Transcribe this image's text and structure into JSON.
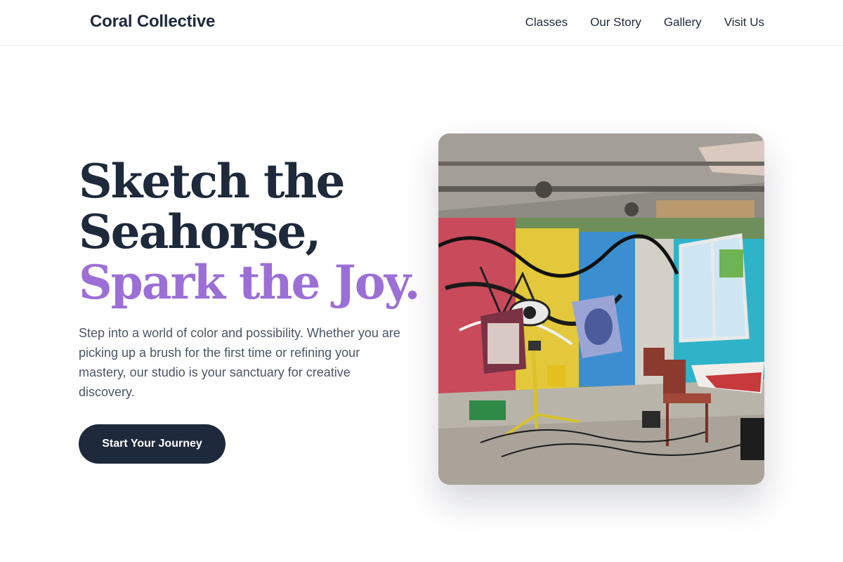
{
  "header": {
    "brand": "Coral Collective",
    "nav": [
      "Classes",
      "Our Story",
      "Gallery",
      "Visit Us"
    ]
  },
  "hero": {
    "headline_line1": "Sketch the",
    "headline_line2": "Seahorse,",
    "headline_accent": "Spark the Joy.",
    "description": "Step into a world of color and possibility. Whether you are picking up a brush for the first time or refining your mastery, our studio is your sanctuary for creative discovery.",
    "cta_label": "Start Your Journey"
  },
  "colors": {
    "primary": "#1e293b",
    "accent": "#9b6fd6",
    "body_text": "#4b5563"
  }
}
